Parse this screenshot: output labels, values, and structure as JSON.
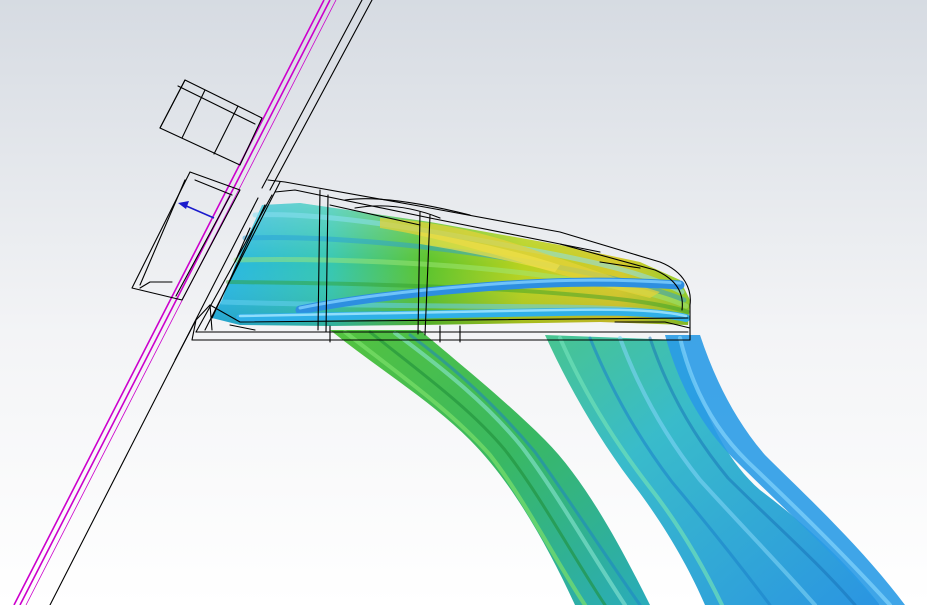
{
  "scene": {
    "background_top": "#d6dbe2",
    "background_bottom": "#ffffff",
    "wireframe_color": "#000000",
    "sketch_line_color": "#cc00cc",
    "vector_arrow_color": "#1a1acc",
    "flow_colors": {
      "low": "#29a6e8",
      "mid_low": "#22c7c0",
      "mid": "#3fbf2a",
      "high": "#c9d51e",
      "peak": "#e0c838"
    }
  }
}
